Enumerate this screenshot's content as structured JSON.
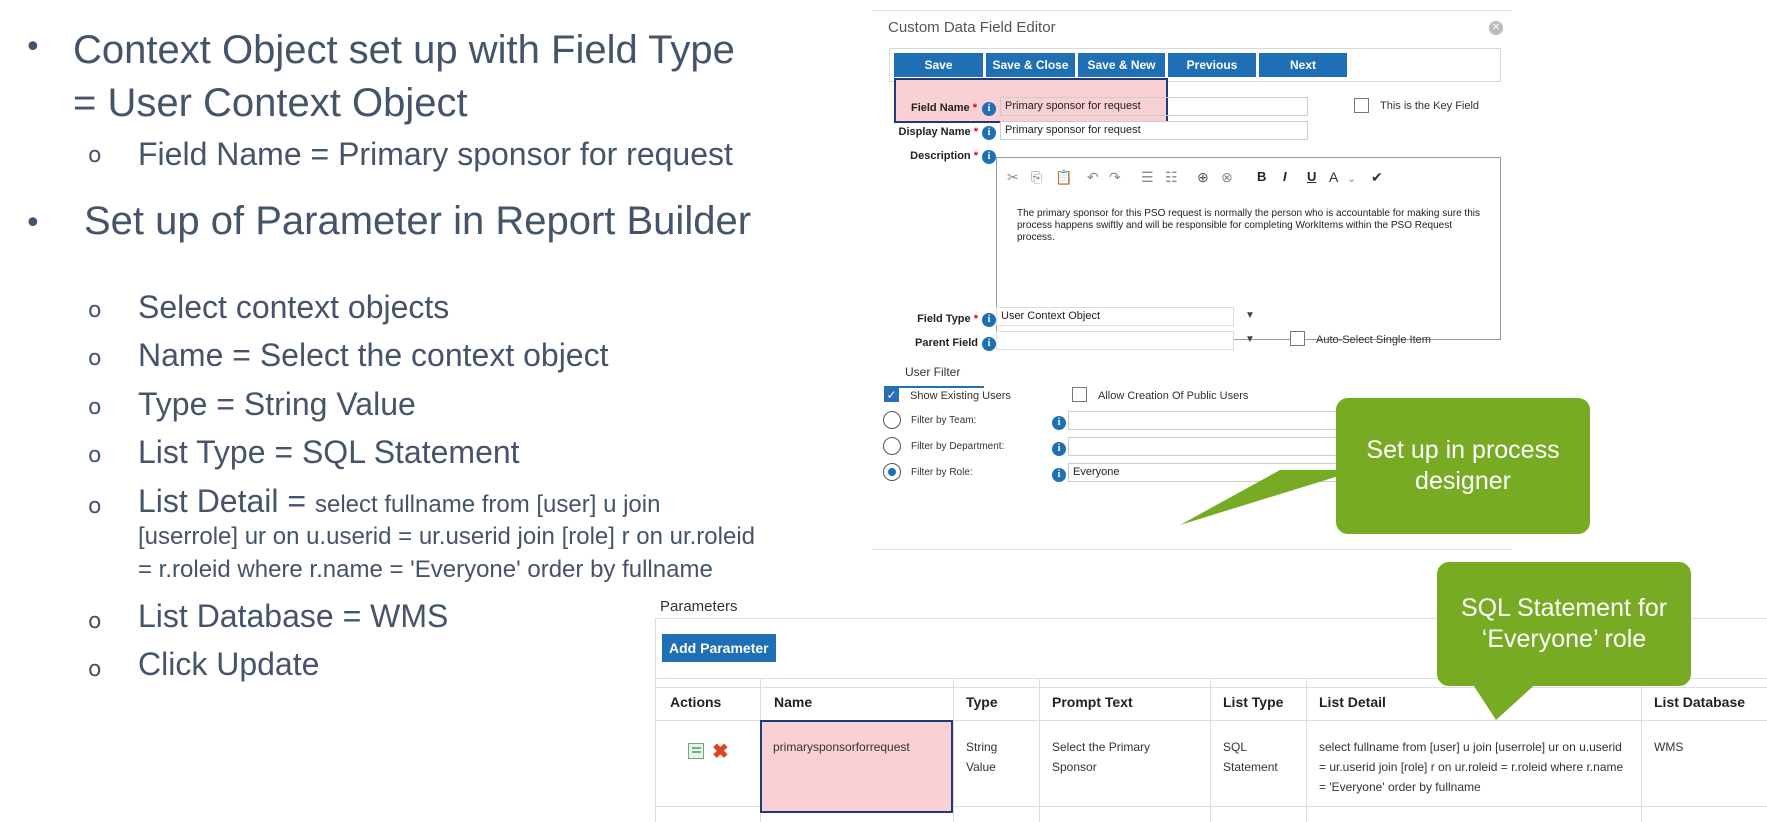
{
  "slide": {
    "bullet1": {
      "line1": "Context Object set up with Field Type",
      "line2": "= User Context Object"
    },
    "bullet1_sub": [
      "Field Name = Primary sponsor for request"
    ],
    "bullet2": "Set up of Parameter in Report Builder",
    "bullet2_sub": {
      "select": "Select context objects",
      "name": "Name = Select the context object",
      "type": "Type = String Value",
      "list_type": "List Type = SQL Statement",
      "list_detail_prefix": "List Detail = ",
      "list_detail_line1": "select fullname from [user] u join",
      "list_detail_line2": "[userrole] ur on u.userid = ur.userid join [role] r on ur.roleid",
      "list_detail_line3": "= r.roleid where r.name = 'Everyone' order by fullname",
      "list_database": "List Database = WMS",
      "click_update": "Click Update"
    }
  },
  "editor": {
    "title": "Custom Data Field Editor",
    "buttons": {
      "save": "Save",
      "save_close": "Save & Close",
      "save_new": "Save & New",
      "previous": "Previous",
      "next": "Next"
    },
    "field_name_label": "Field Name",
    "field_name_value": "Primary sponsor for request",
    "key_field_label": "This is the Key Field",
    "display_name_label": "Display Name",
    "display_name_value": "Primary sponsor for request",
    "description_label": "Description",
    "description_text": "The primary sponsor for this PSO request is normally the person who is accountable for making sure this process happens swiftly and will be responsible for completing WorkItems within the PSO Request process.",
    "field_type_label": "Field Type",
    "field_type_value": "User Context Object",
    "parent_field_label": "Parent Field",
    "parent_field_value": "",
    "auto_select_label": "Auto-Select Single Item",
    "user_filter_tab": "User Filter",
    "show_existing_label": "Show Existing Users",
    "allow_public_label": "Allow Creation Of Public Users",
    "filter_team_label": "Filter by Team:",
    "filter_dept_label": "Filter by Department:",
    "filter_role_label": "Filter by Role:",
    "filter_role_value": "Everyone",
    "required_mark": "*"
  },
  "callouts": {
    "process_designer": "Set up in process designer",
    "sql_statement": "SQL Statement for ‘Everyone’ role"
  },
  "parameters": {
    "title": "Parameters",
    "add_button": "Add Parameter",
    "headers": [
      "Actions",
      "Name",
      "Type",
      "Prompt Text",
      "List Type",
      "List Detail",
      "List Database"
    ],
    "row": {
      "name": "primarysponsorforrequest",
      "type": "String Value",
      "prompt": "Select the Primary Sponsor",
      "list_type": "SQL Statement",
      "list_detail": "select fullname from [user] u join [userrole] ur on u.userid = ur.userid join [role] r on ur.roleid = r.roleid where r.name = 'Everyone' order by fullname",
      "list_database": "WMS"
    }
  },
  "colors": {
    "accent_blue": "#1f6fb5",
    "callout_green": "#77ab24",
    "highlight_pink": "#f9d0d3",
    "highlight_border": "#1f3a7a",
    "text_slate": "#44546a"
  }
}
